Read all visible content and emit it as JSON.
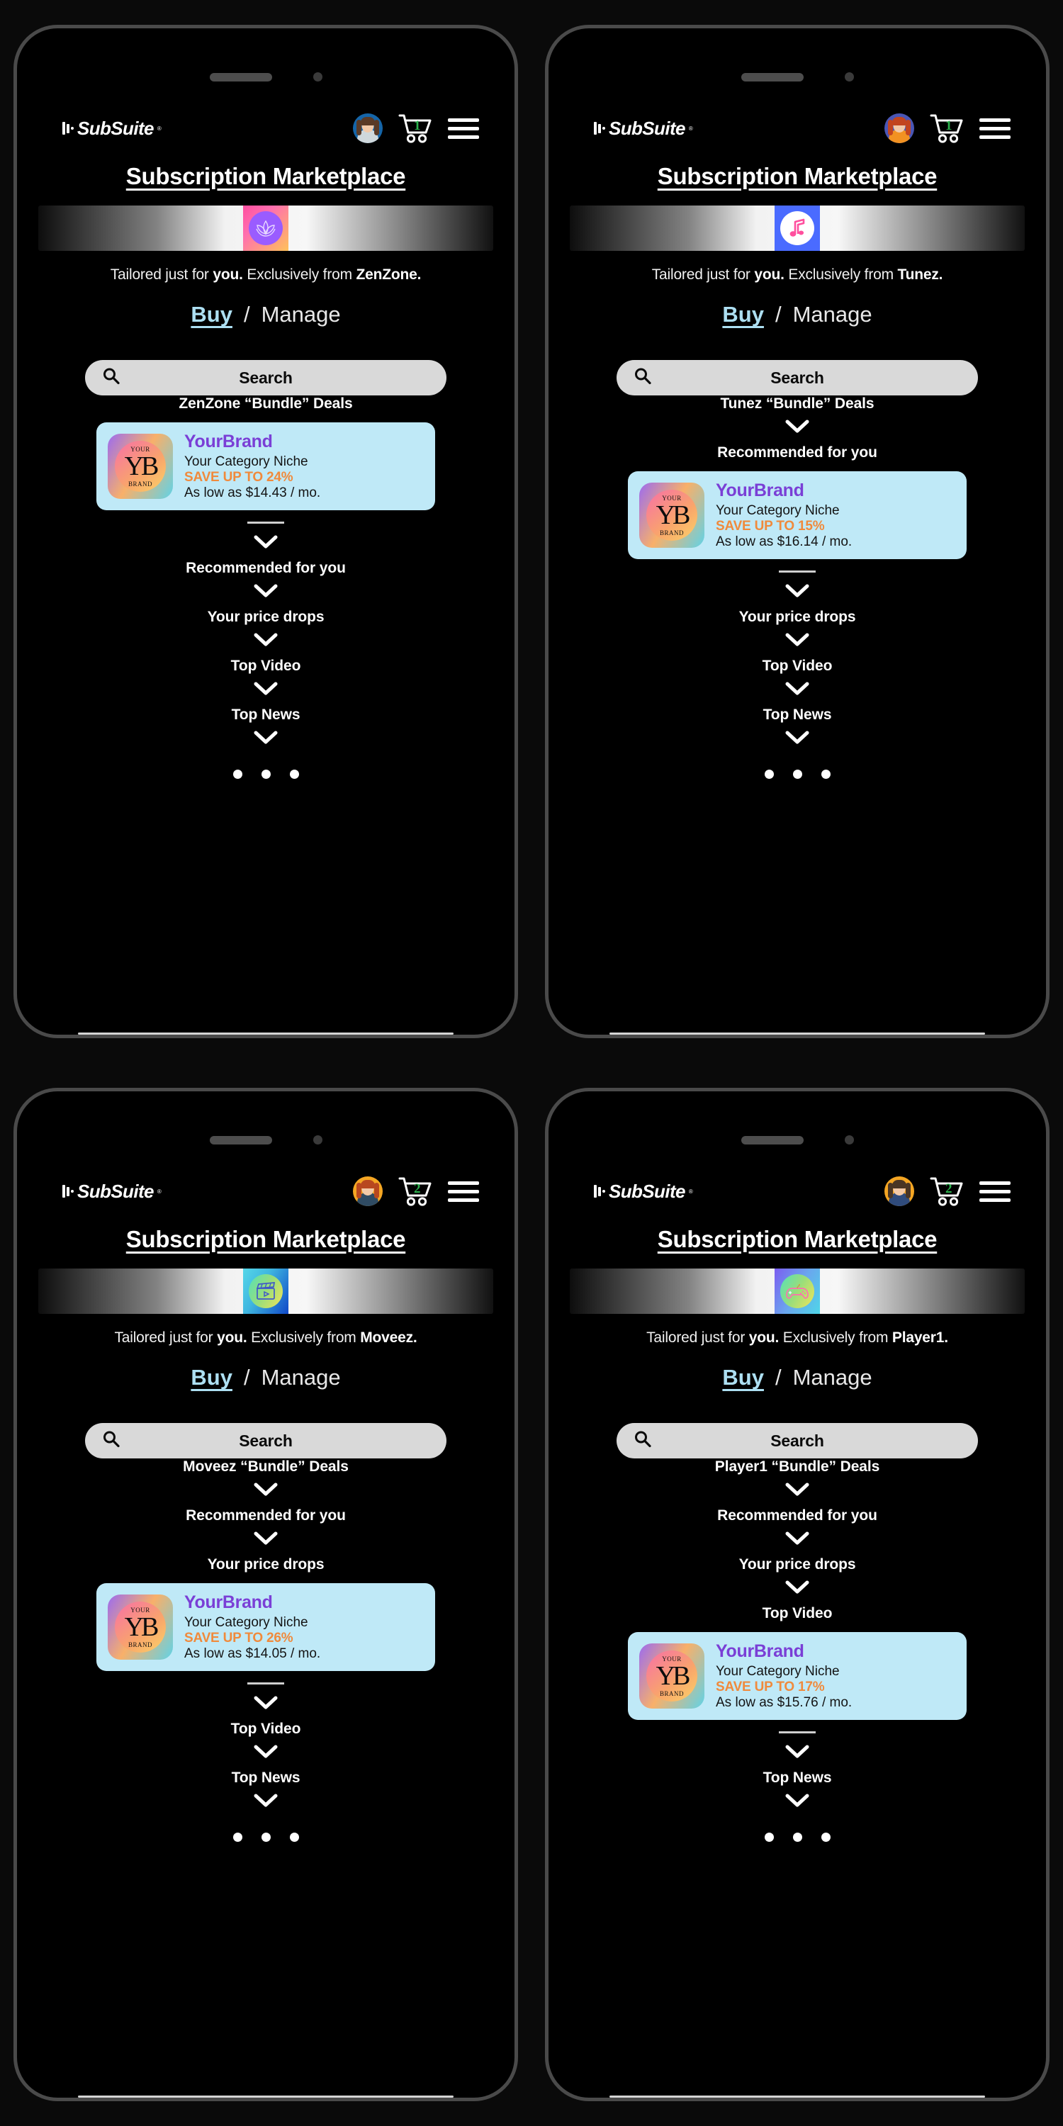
{
  "app": {
    "logo_text": "SubSuite",
    "logo_tm": "®",
    "page_title": "Subscription Marketplace",
    "search_label": "Search",
    "search_icon": "search-icon",
    "menu_icon": "hamburger-menu-icon",
    "cart_icon": "shopping-cart-icon",
    "avatar_icon": "user-avatar",
    "chevron_icon": "chevron-down-icon",
    "buy_label": "Buy",
    "separator": "/",
    "manage_label": "Manage",
    "tagline_prefix": "Tailored just for ",
    "tagline_you": "you.",
    "tagline_mid": " Exclusively from ",
    "colors": {
      "card_bg": "#bfe9f7",
      "brand_purple": "#7a3fd6",
      "save_orange": "#f08a3c",
      "buy_blue": "#addff2",
      "cart_green": "#2bb24c",
      "search_bg": "#d9d9d9"
    }
  },
  "panels": [
    {
      "id": "zenzone",
      "brand": "ZenZone",
      "brand_punct": "ZenZone.",
      "cart_count": "1",
      "avatar_bg": "#1565a8",
      "avatar_hair": "#5a3a26",
      "avatar_body": "#cfd8dc",
      "tile_gradient": "linear-gradient(135deg, #ff4fa0 0%, #ff6fae 35%, #ffc25a 100%)",
      "circle_bg": "#9a5cff",
      "circle_icon": "lotus-icon",
      "sections": [
        {
          "label": "ZenZone “Bundle” Deals",
          "has_card": true
        },
        {
          "label": "Recommended for you",
          "has_card": false
        },
        {
          "label": "Your price drops",
          "has_card": false
        },
        {
          "label": "Top Video",
          "has_card": false
        },
        {
          "label": "Top News",
          "has_card": false
        }
      ],
      "card": {
        "brand": "YourBrand",
        "niche": "Your Category Niche",
        "save": "SAVE UP TO 24%",
        "price": "As low as $14.43 / mo.",
        "logo_top": "YOUR",
        "logo_mid": "YB",
        "logo_bot": "BRAND"
      },
      "dots": 3
    },
    {
      "id": "tunez",
      "brand": "Tunez",
      "brand_punct": "Tunez.",
      "cart_count": "1",
      "avatar_bg": "#4a56b5",
      "avatar_hair": "#c2451f",
      "avatar_body": "#f29222",
      "tile_gradient": "linear-gradient(135deg, #4a6bff 0%, #4a6bff 100%)",
      "circle_bg": "#ffffff",
      "circle_icon": "music-note-icon",
      "sections": [
        {
          "label": "Tunez “Bundle” Deals",
          "has_card": false
        },
        {
          "label": "Recommended for you",
          "has_card": true
        },
        {
          "label": "Your price drops",
          "has_card": false
        },
        {
          "label": "Top Video",
          "has_card": false
        },
        {
          "label": "Top News",
          "has_card": false
        }
      ],
      "card": {
        "brand": "YourBrand",
        "niche": "Your Category Niche",
        "save": "SAVE UP TO 15%",
        "price": "As low as $16.14 / mo.",
        "logo_top": "YOUR",
        "logo_mid": "YB",
        "logo_bot": "BRAND"
      },
      "dots": 3
    },
    {
      "id": "moveez",
      "brand": "Moveez",
      "brand_punct": "Moveez.",
      "cart_count": "2",
      "avatar_bg": "#f5a623",
      "avatar_hair": "#b8471f",
      "avatar_body": "#2f4b63",
      "tile_gradient": "linear-gradient(120deg, #55d6e8 0%, #3fb6e0 40%, #1048c8 100%)",
      "circle_bg": "linear-gradient(120deg, #55e0b8 0%, #9ade7a 50%, #f2e45a 100%)",
      "circle_icon": "clapperboard-icon",
      "sections": [
        {
          "label": "Moveez “Bundle” Deals",
          "has_card": false
        },
        {
          "label": "Recommended for you",
          "has_card": false
        },
        {
          "label": "Your price drops",
          "has_card": true
        },
        {
          "label": "Top Video",
          "has_card": false
        },
        {
          "label": "Top News",
          "has_card": false
        }
      ],
      "card": {
        "brand": "YourBrand",
        "niche": "Your Category Niche",
        "save": "SAVE UP TO 26%",
        "price": "As low as $14.05 / mo.",
        "logo_top": "YOUR",
        "logo_mid": "YB",
        "logo_bot": "BRAND"
      },
      "dots": 3
    },
    {
      "id": "player1",
      "brand": "Player1",
      "brand_punct": "Player1.",
      "cart_count": "2",
      "avatar_bg": "#f5a623",
      "avatar_hair": "#4a3524",
      "avatar_body": "#2f4b7c",
      "tile_gradient": "linear-gradient(120deg, #7b5cf0 0%, #6aa6ee 50%, #4fd6e8 100%)",
      "circle_bg": "linear-gradient(120deg, #55e0b8 0%, #9ade7a 50%, #f2e45a 100%)",
      "circle_icon": "game-controller-icon",
      "sections": [
        {
          "label": "Player1 “Bundle” Deals",
          "has_card": false
        },
        {
          "label": "Recommended for you",
          "has_card": false
        },
        {
          "label": "Your price drops",
          "has_card": false
        },
        {
          "label": "Top Video",
          "has_card": true
        },
        {
          "label": "Top News",
          "has_card": false
        }
      ],
      "card": {
        "brand": "YourBrand",
        "niche": "Your Category Niche",
        "save": "SAVE UP TO 17%",
        "price": "As low as $15.76 / mo.",
        "logo_top": "YOUR",
        "logo_mid": "YB",
        "logo_bot": "BRAND"
      },
      "dots": 3
    }
  ]
}
